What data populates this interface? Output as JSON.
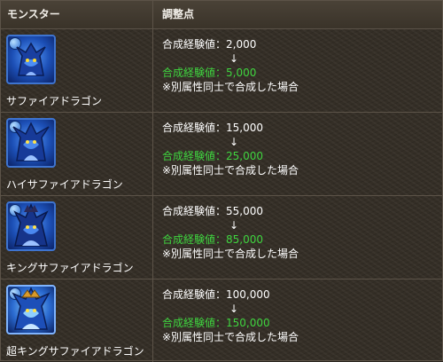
{
  "header": {
    "col_monster": "モンスター",
    "col_adjustment": "調整点"
  },
  "rows": [
    {
      "name": "サファイアドラゴン",
      "old": "合成経験値：2,000",
      "arrow": "↓",
      "new": "合成経験値：5,000",
      "note": "※別属性同士で合成した場合"
    },
    {
      "name": "ハイサファイアドラゴン",
      "old": "合成経験値：15,000",
      "arrow": "↓",
      "new": "合成経験値：25,000",
      "note": "※別属性同士で合成した場合"
    },
    {
      "name": "キングサファイアドラゴン",
      "old": "合成経験値：55,000",
      "arrow": "↓",
      "new": "合成経験値：85,000",
      "note": "※別属性同士で合成した場合"
    },
    {
      "name": "超キングサファイアドラゴン",
      "old": "合成経験値：100,000",
      "arrow": "↓",
      "new": "合成経験値：150,000",
      "note": "※別属性同士で合成した場合"
    }
  ],
  "colors": {
    "new_value": "#3fd43f",
    "frame_blue": "#3e74d0",
    "border": "#5c5348"
  }
}
